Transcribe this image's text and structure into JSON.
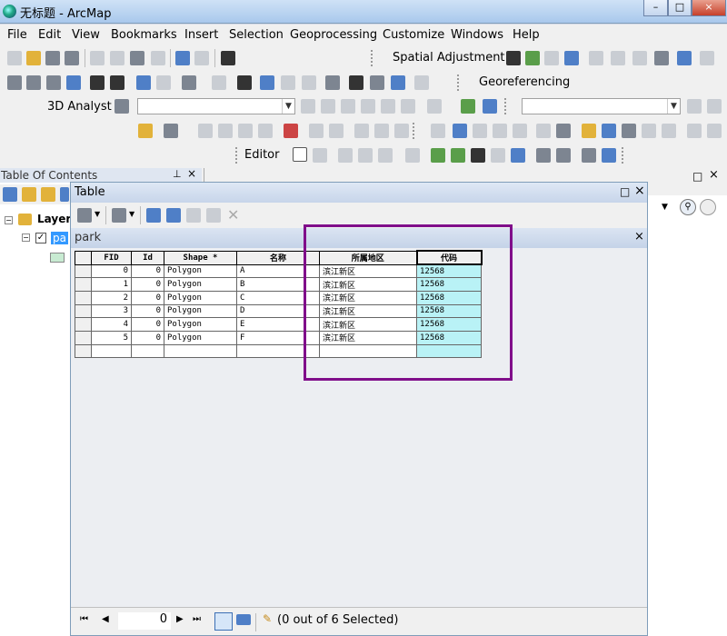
{
  "window": {
    "title": "无标题 - ArcMap",
    "minimize": "–",
    "maximize": "□",
    "close": "×"
  },
  "menu": [
    "File",
    "Edit",
    "View",
    "Bookmarks",
    "Insert",
    "Selection",
    "Geoprocessing",
    "Customize",
    "Windows",
    "Help"
  ],
  "toolbars": {
    "spatial_adjustment": "Spatial Adjustment",
    "georeferencing": "Georeferencing",
    "analyst_3d": "3D Analyst",
    "editor": "Editor"
  },
  "toc": {
    "title": "Table Of Contents",
    "layers_label": "Layers",
    "layer_name": "pa"
  },
  "table_window": {
    "title": "Table",
    "tab_name": "park",
    "columns": [
      "FID",
      "Id",
      "Shape *",
      "名称",
      "所属地区",
      "代码"
    ],
    "rows": [
      [
        "0",
        "0",
        "Polygon",
        "A",
        "滨江新区",
        "12568"
      ],
      [
        "1",
        "0",
        "Polygon",
        "B",
        "滨江新区",
        "12568"
      ],
      [
        "2",
        "0",
        "Polygon",
        "C",
        "滨江新区",
        "12568"
      ],
      [
        "3",
        "0",
        "Polygon",
        "D",
        "滨江新区",
        "12568"
      ],
      [
        "4",
        "0",
        "Polygon",
        "E",
        "滨江新区",
        "12568"
      ],
      [
        "5",
        "0",
        "Polygon",
        "F",
        "滨江新区",
        "12568"
      ]
    ],
    "record_position": "0",
    "selection_status": "(0 out of 6 Selected)"
  },
  "colors": {
    "highlight_box": "#800e8a",
    "selected_column": "#b9f2f6"
  }
}
